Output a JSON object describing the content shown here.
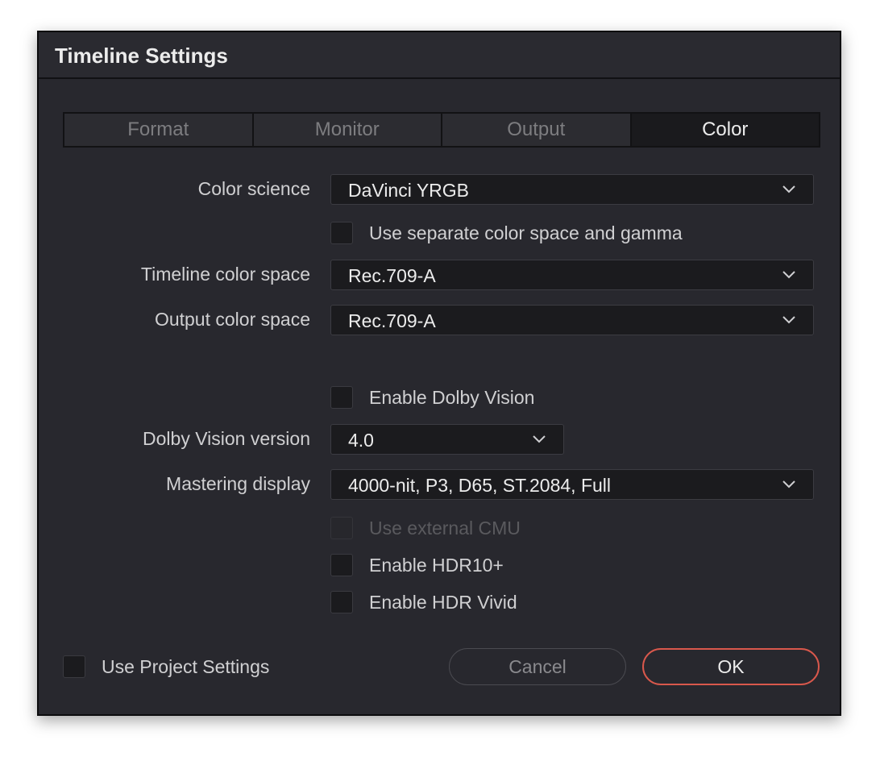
{
  "dialog": {
    "title": "Timeline Settings"
  },
  "tabs": [
    {
      "label": "Format",
      "active": false
    },
    {
      "label": "Monitor",
      "active": false
    },
    {
      "label": "Output",
      "active": false
    },
    {
      "label": "Color",
      "active": true
    }
  ],
  "fields": {
    "color_science": {
      "label": "Color science",
      "value": "DaVinci YRGB"
    },
    "separate_color_space": {
      "label": "Use separate color space and gamma",
      "checked": false
    },
    "timeline_color_space": {
      "label": "Timeline color space",
      "value": "Rec.709-A"
    },
    "output_color_space": {
      "label": "Output color space",
      "value": "Rec.709-A"
    },
    "enable_dolby_vision": {
      "label": "Enable Dolby Vision",
      "checked": false
    },
    "dolby_vision_version": {
      "label": "Dolby Vision version",
      "value": "4.0"
    },
    "mastering_display": {
      "label": "Mastering display",
      "value": "4000-nit, P3, D65, ST.2084, Full"
    },
    "use_external_cmu": {
      "label": "Use external CMU",
      "checked": false,
      "disabled": true
    },
    "enable_hdr10_plus": {
      "label": "Enable HDR10+",
      "checked": false
    },
    "enable_hdr_vivid": {
      "label": "Enable HDR Vivid",
      "checked": false
    }
  },
  "footer": {
    "use_project_settings": {
      "label": "Use Project Settings",
      "checked": false
    },
    "cancel_label": "Cancel",
    "ok_label": "OK"
  },
  "colors": {
    "dialog_bg": "#28282e",
    "field_bg": "#1b1b1e",
    "accent_ok_border": "#d9584c",
    "text": "#d0d0d2"
  },
  "icons": {
    "dropdown": "chevron-down-icon"
  }
}
